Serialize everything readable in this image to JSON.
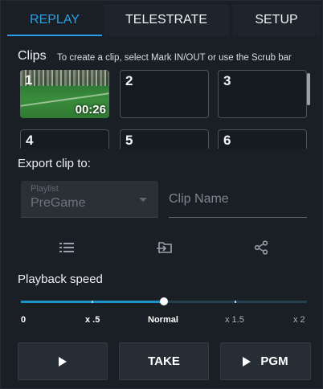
{
  "tabs": [
    {
      "label": "REPLAY"
    },
    {
      "label": "TELESTRATE"
    },
    {
      "label": "SETUP"
    }
  ],
  "clips": {
    "label": "Clips",
    "hint": "To create a clip, select Mark IN/OUT or use the Scrub bar",
    "items": [
      {
        "number": "1",
        "duration": "00:26"
      },
      {
        "number": "2"
      },
      {
        "number": "3"
      },
      {
        "number": "4"
      },
      {
        "number": "5"
      },
      {
        "number": "6"
      }
    ]
  },
  "export": {
    "label": "Export clip to:",
    "playlist_label": "Playlist",
    "playlist_value": "PreGame",
    "clip_name_placeholder": "Clip Name"
  },
  "icons": [
    "playlist-add-icon",
    "import-icon",
    "share-icon"
  ],
  "playback": {
    "label": "Playback speed",
    "ticks": [
      "0",
      "x .5",
      "Normal",
      "x 1.5",
      "x 2"
    ],
    "value": "Normal"
  },
  "buttons": {
    "take": "TAKE",
    "pgm": "PGM"
  },
  "colors": {
    "accent": "#2b9fe6",
    "slider_fill": "#1d93c9"
  }
}
